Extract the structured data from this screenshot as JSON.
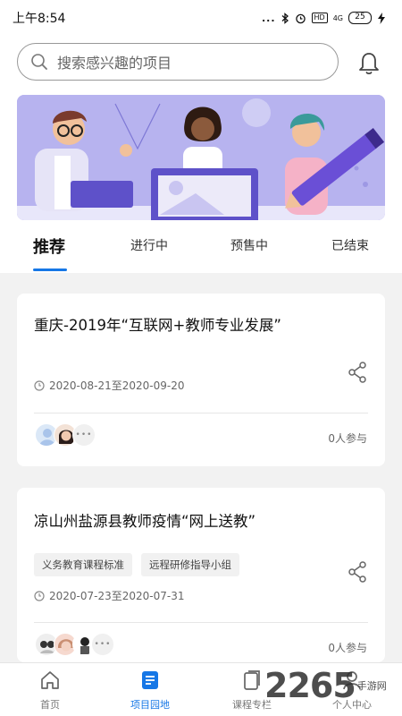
{
  "status_bar": {
    "time": "上午8:54",
    "dots": "...",
    "hd": "HD",
    "signal": "4G",
    "battery": "25"
  },
  "search": {
    "placeholder": "搜索感兴趣的项目"
  },
  "tabs": [
    {
      "label": "推荐",
      "active": true
    },
    {
      "label": "进行中",
      "active": false
    },
    {
      "label": "预售中",
      "active": false
    },
    {
      "label": "已结束",
      "active": false
    }
  ],
  "cards": [
    {
      "title": "重庆-2019年“互联网+教师专业发展”",
      "tags": [],
      "date": "2020-08-21至2020-09-20",
      "participants": "0人参与",
      "more_avatars": "•••"
    },
    {
      "title": "凉山州盐源县教师疫情“网上送教”",
      "tags": [
        "义务教育课程标准",
        "远程研修指导小组"
      ],
      "date": "2020-07-23至2020-07-31",
      "participants": "0人参与",
      "more_avatars": "•••"
    }
  ],
  "bottom_nav": [
    {
      "label": "首页",
      "icon": "home-icon",
      "active": false
    },
    {
      "label": "项目园地",
      "icon": "project-icon",
      "active": true
    },
    {
      "label": "课程专栏",
      "icon": "course-icon",
      "active": false
    },
    {
      "label": "个人中心",
      "icon": "user-icon",
      "active": false
    }
  ],
  "watermark": {
    "number": "2265",
    "suffix": "手游网"
  },
  "colors": {
    "accent": "#1677e6",
    "banner_bg": "#b7b3ef"
  }
}
